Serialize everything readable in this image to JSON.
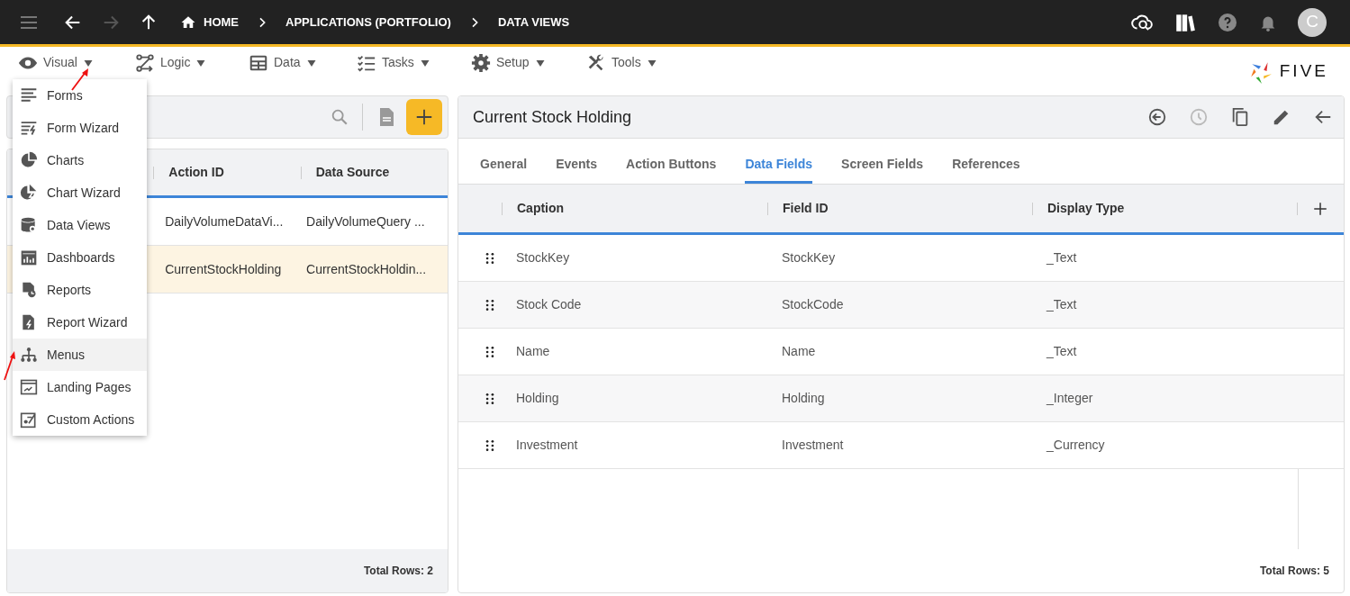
{
  "top_bar": {
    "nav": [
      {
        "kind": "back",
        "disabled": false
      },
      {
        "kind": "forward",
        "disabled": true
      },
      {
        "kind": "up",
        "disabled": false
      }
    ],
    "breadcrumbs": [
      "HOME",
      "APPLICATIONS (PORTFOLIO)",
      "DATA VIEWS"
    ],
    "avatar": "C"
  },
  "toolbar": {
    "menus": [
      "Visual",
      "Logic",
      "Data",
      "Tasks",
      "Setup",
      "Tools"
    ],
    "logo": "FIVE"
  },
  "visual_menu": {
    "items": [
      {
        "label": "Forms",
        "highlighted": false
      },
      {
        "label": "Form Wizard",
        "highlighted": false
      },
      {
        "label": "Charts",
        "highlighted": false
      },
      {
        "label": "Chart Wizard",
        "highlighted": false
      },
      {
        "label": "Data Views",
        "highlighted": false
      },
      {
        "label": "Dashboards",
        "highlighted": false
      },
      {
        "label": "Reports",
        "highlighted": false
      },
      {
        "label": "Report Wizard",
        "highlighted": false
      },
      {
        "label": "Menus",
        "highlighted": true
      },
      {
        "label": "Landing Pages",
        "highlighted": false
      },
      {
        "label": "Custom Actions",
        "highlighted": false
      }
    ]
  },
  "list_panel": {
    "columns": [
      "Action ID",
      "Data Source"
    ],
    "rows": [
      {
        "cells": [
          "DailyVolumeDataVi...",
          "DailyVolumeQuery ..."
        ],
        "selected": false
      },
      {
        "cells": [
          "CurrentStockHolding",
          "CurrentStockHoldin..."
        ],
        "selected": true
      }
    ],
    "footer": "Total Rows: 2"
  },
  "detail_panel": {
    "title": "Current Stock Holding",
    "actions": [
      {
        "kind": "back-circle",
        "disabled": false
      },
      {
        "kind": "history",
        "disabled": true
      },
      {
        "kind": "copy",
        "disabled": false
      },
      {
        "kind": "edit",
        "disabled": false
      },
      {
        "kind": "close",
        "disabled": false
      }
    ],
    "tabs": [
      {
        "label": "General",
        "selected": false
      },
      {
        "label": "Events",
        "selected": false
      },
      {
        "label": "Action Buttons",
        "selected": false
      },
      {
        "label": "Data Fields",
        "selected": true
      },
      {
        "label": "Screen Fields",
        "selected": false
      },
      {
        "label": "References",
        "selected": false
      }
    ],
    "columns": [
      "Caption",
      "Field ID",
      "Display Type"
    ],
    "rows": [
      [
        "StockKey",
        "StockKey",
        "_Text"
      ],
      [
        "Stock Code",
        "StockCode",
        "_Text"
      ],
      [
        "Name",
        "Name",
        "_Text"
      ],
      [
        "Holding",
        "Holding",
        "_Integer"
      ],
      [
        "Investment",
        "Investment",
        "_Currency"
      ]
    ],
    "footer": "Total Rows: 5"
  }
}
